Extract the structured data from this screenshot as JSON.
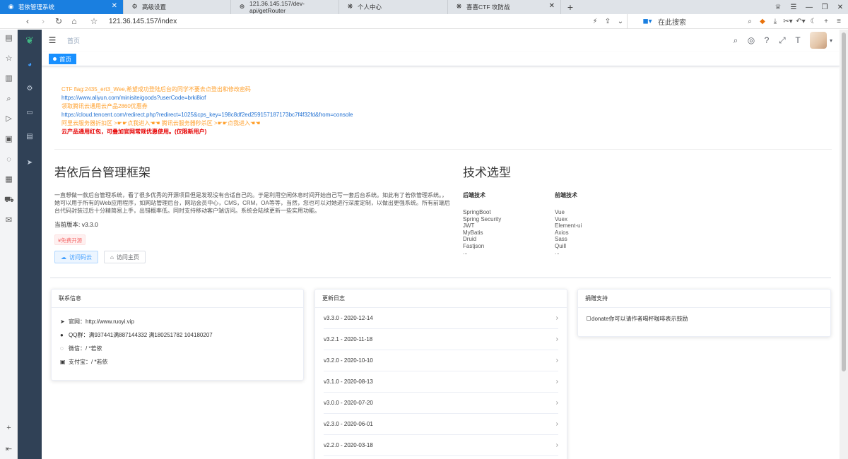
{
  "browser": {
    "tabs": [
      {
        "title": "若依管理系统",
        "icon": "app-icon",
        "active": true
      },
      {
        "title": "高级设置",
        "icon": "settings-icon",
        "active": false
      },
      {
        "title": "121.36.145.157/dev-api/getRouter",
        "icon": "page-icon",
        "active": false
      },
      {
        "title": "个人中心",
        "icon": "gear-icon",
        "active": false
      },
      {
        "title": "喜喜CTF 攻防战",
        "icon": "gear-icon",
        "active": false
      }
    ],
    "url": "121.36.145.157/index",
    "search_placeholder": "在此搜索"
  },
  "app": {
    "breadcrumb": "首页",
    "tag_label": "首页"
  },
  "notice": {
    "lines": [
      {
        "text": "CTF flag:2435_ert3_Wee,希望成功登陆后台的同学不要去点登出和修改密码",
        "style": "orange"
      },
      {
        "text": "https://www.aliyun.com/minisite/goods?userCode=brki8iof",
        "style": "blue"
      },
      {
        "text": "领取腾讯云通用云产品2860优惠券",
        "style": "orange"
      },
      {
        "text": "https://cloud.tencent.com/redirect.php?redirect=1025&cps_key=198c8df2ed259157187173bc7f4f32fd&from=console",
        "style": "blue"
      },
      {
        "text": "阿里云服务器折扣区 >☛☛点我进入☚☚ 腾讯云服务器秒杀区 >☛☛点我进入☚☚",
        "style": "orange"
      },
      {
        "text": "云产品通用红包，可叠加官网常规优惠使用。(仅限新用户)",
        "style": "red"
      }
    ]
  },
  "intro": {
    "title": "若依后台管理框架",
    "description": "一直想做一款后台管理系统，看了很多优秀的开源项目但是发现没有合适自己的。于是利用空闲休息时间开始自己写一套后台系统。如此有了若依管理系统。，她可以用于所有的Web应用程序，如网站管理后台，网站会员中心，CMS，CRM，OA等等，当然，您也可以对她进行深度定制，以做出更强系统。所有前端后台代码封装过后十分精简易上手，出错概率低。同时支持移动客户端访问。系统会陆续更新一些实用功能。",
    "version_label": "当前版本: v3.3.0",
    "badge": "¥免费开源",
    "btn_gitee": "访问码云",
    "btn_home": "访问主页"
  },
  "tech": {
    "title": "技术选型",
    "backend_title": "后端技术",
    "backend": [
      "SpringBoot",
      "Spring Security",
      "JWT",
      "MyBatis",
      "Druid",
      "Fastjson",
      "..."
    ],
    "frontend_title": "前端技术",
    "frontend": [
      "Vue",
      "Vuex",
      "Element-ui",
      "Axios",
      "Sass",
      "Quill",
      "..."
    ]
  },
  "contact": {
    "title": "联系信息",
    "rows": [
      {
        "icon": "send-icon",
        "text": "官网：http://www.ruoyi.vip"
      },
      {
        "icon": "user-icon",
        "text": "QQ群：满937441满887144332 满180251782 104180207"
      },
      {
        "icon": "chat-icon",
        "text": "微信：/ *若依"
      },
      {
        "icon": "money-icon",
        "text": "支付宝：/ *若依"
      }
    ]
  },
  "changelog": {
    "title": "更新日志",
    "items": [
      "v3.3.0 - 2020-12-14",
      "v3.2.1 - 2020-11-18",
      "v3.2.0 - 2020-10-10",
      "v3.1.0 - 2020-08-13",
      "v3.0.0 - 2020-07-20",
      "v2.3.0 - 2020-06-01",
      "v2.2.0 - 2020-03-18"
    ]
  },
  "donate": {
    "title": "捐赠支持",
    "image_alt": "donate你可以请作者喝杯咖啡表示鼓励"
  },
  "colors": {
    "sidebar_bg": "#304156",
    "accent_blue": "#1890ff",
    "notice_orange": "#ff8c00",
    "notice_red": "#e60000"
  }
}
